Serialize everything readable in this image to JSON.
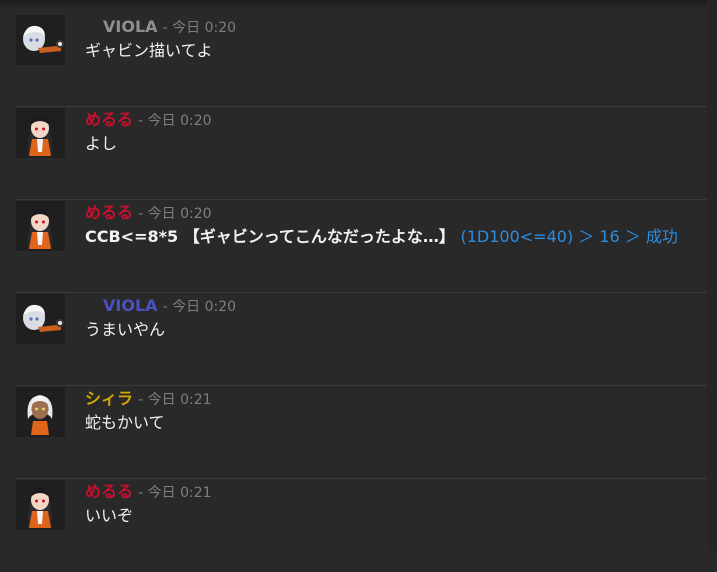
{
  "messages": [
    {
      "sender": "VIOLA",
      "sender_color": "#8f8f8f",
      "separator": "-",
      "time": "今日 0:20",
      "text": "ギャビン描いてよ",
      "avatar": "viola-avatar-icon"
    },
    {
      "sender": "めるる",
      "sender_color": "#c8102e",
      "separator": "-",
      "time": "今日 0:20",
      "text": "よし",
      "avatar": "meruru-avatar-icon"
    },
    {
      "sender": "めるる",
      "sender_color": "#c8102e",
      "separator": "-",
      "time": "今日 0:20",
      "text": "CCB<=8*5 【ギャビンってこんなだったよな…】",
      "dice_result": "(1D100<=40) ＞ 16 ＞ 成功",
      "avatar": "meruru-avatar-icon"
    },
    {
      "sender": "VIOLA",
      "sender_color": "#4a52c2",
      "separator": "-",
      "time": "今日 0:20",
      "text": "うまいやん",
      "avatar": "viola-avatar-icon"
    },
    {
      "sender": "シィラ",
      "sender_color": "#d6a900",
      "separator": "-",
      "time": "今日 0:21",
      "text": "蛇もかいて",
      "avatar": "shira-avatar-icon"
    },
    {
      "sender": "めるる",
      "sender_color": "#c8102e",
      "separator": "-",
      "time": "今日 0:21",
      "text": "いいぞ",
      "avatar": "meruru-avatar-icon"
    }
  ],
  "colors": {
    "background": "#292929",
    "divider": "#3b3b3b",
    "timestamp": "#7e7e7e",
    "message_text": "#f2f2f2",
    "dice_result": "#2b8de0"
  }
}
